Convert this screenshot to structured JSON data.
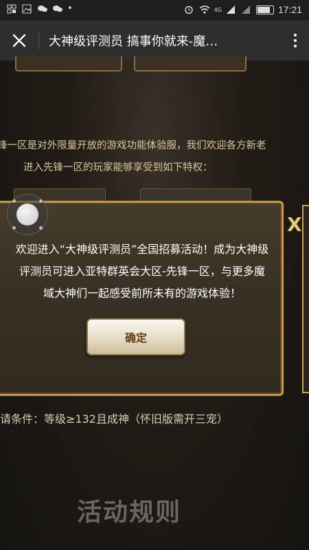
{
  "status_bar": {
    "network": "4G",
    "time": "17:21"
  },
  "title_bar": {
    "title": "大神级评测员  搞事你就来-魔…"
  },
  "page": {
    "intro_line1": "锋一区是对外限量开放的游戏功能体验服，我们欢迎各方新老",
    "intro_line2": "进入先锋一区的玩家能够享受到如下特权：",
    "condition": "请条件：等级≥132且成神（怀旧版需开三宠）",
    "section_title": "活动规则",
    "side_close": "X"
  },
  "modal": {
    "message": "欢迎进入“大神级评测员”全国招募活动！成为大神级\n评测员可进入亚特群英会大区-先锋一区，与更多魔\n域大神们一起感受前所未有的游戏体验！",
    "confirm_label": "确定"
  }
}
